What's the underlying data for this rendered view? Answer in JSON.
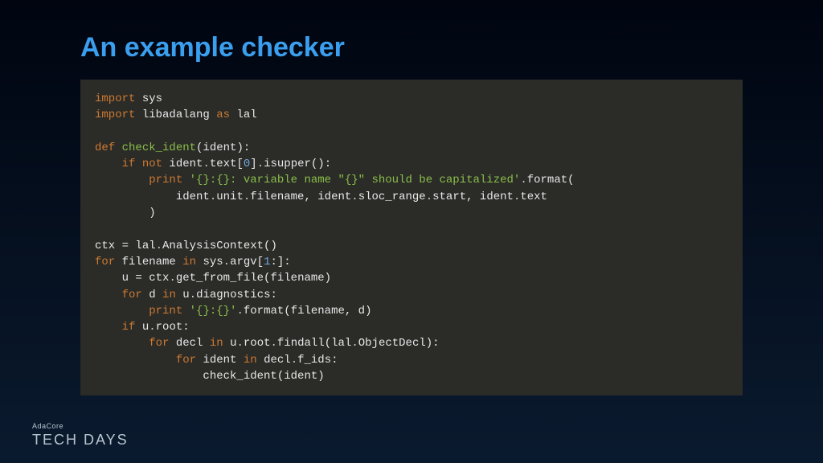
{
  "title": "An example checker",
  "footer": {
    "brand": "AdaCore",
    "event": "TECH DAYS"
  },
  "code": {
    "l1": {
      "t1": "import",
      "t2": " sys"
    },
    "l2": {
      "t1": "import",
      "t2": " libadalang ",
      "t3": "as",
      "t4": " lal"
    },
    "l3": "",
    "l4": {
      "t1": "def ",
      "t2": "check_ident",
      "t3": "(ident):"
    },
    "l5": {
      "t1": "    ",
      "t2": "if not",
      "t3": " ident",
      "t4": ".",
      "t5": "text[",
      "t6": "0",
      "t7": "]",
      "t8": ".",
      "t9": "isupper():"
    },
    "l6": {
      "t1": "        ",
      "t2": "print ",
      "t3": "'{}:{}: variable name \"{}\" should be capitalized'",
      "t4": ".",
      "t5": "format("
    },
    "l7": {
      "t1": "            ident",
      "t2": ".",
      "t3": "unit",
      "t4": ".",
      "t5": "filename, ident",
      "t6": ".",
      "t7": "sloc_range",
      "t8": ".",
      "t9": "start, ident",
      "t10": ".",
      "t11": "text"
    },
    "l8": "        )",
    "l9": "",
    "l10": {
      "t1": "ctx ",
      "t2": "=",
      "t3": " lal",
      "t4": ".",
      "t5": "AnalysisContext()"
    },
    "l11": {
      "t1": "for",
      "t2": " filename ",
      "t3": "in",
      "t4": " sys",
      "t5": ".",
      "t6": "argv[",
      "t7": "1",
      "t8": ":]:"
    },
    "l12": {
      "t1": "    u ",
      "t2": "=",
      "t3": " ctx",
      "t4": ".",
      "t5": "get_from_file(filename)"
    },
    "l13": {
      "t1": "    ",
      "t2": "for",
      "t3": " d ",
      "t4": "in",
      "t5": " u",
      "t6": ".",
      "t7": "diagnostics:"
    },
    "l14": {
      "t1": "        ",
      "t2": "print ",
      "t3": "'{}:{}'",
      "t4": ".",
      "t5": "format(filename, d)"
    },
    "l15": {
      "t1": "    ",
      "t2": "if",
      "t3": " u",
      "t4": ".",
      "t5": "root:"
    },
    "l16": {
      "t1": "        ",
      "t2": "for",
      "t3": " decl ",
      "t4": "in",
      "t5": " u",
      "t6": ".",
      "t7": "root",
      "t8": ".",
      "t9": "findall(lal",
      "t10": ".",
      "t11": "ObjectDecl):"
    },
    "l17": {
      "t1": "            ",
      "t2": "for",
      "t3": " ident ",
      "t4": "in",
      "t5": " decl",
      "t6": ".",
      "t7": "f_ids:"
    },
    "l18": "                check_ident(ident)"
  }
}
